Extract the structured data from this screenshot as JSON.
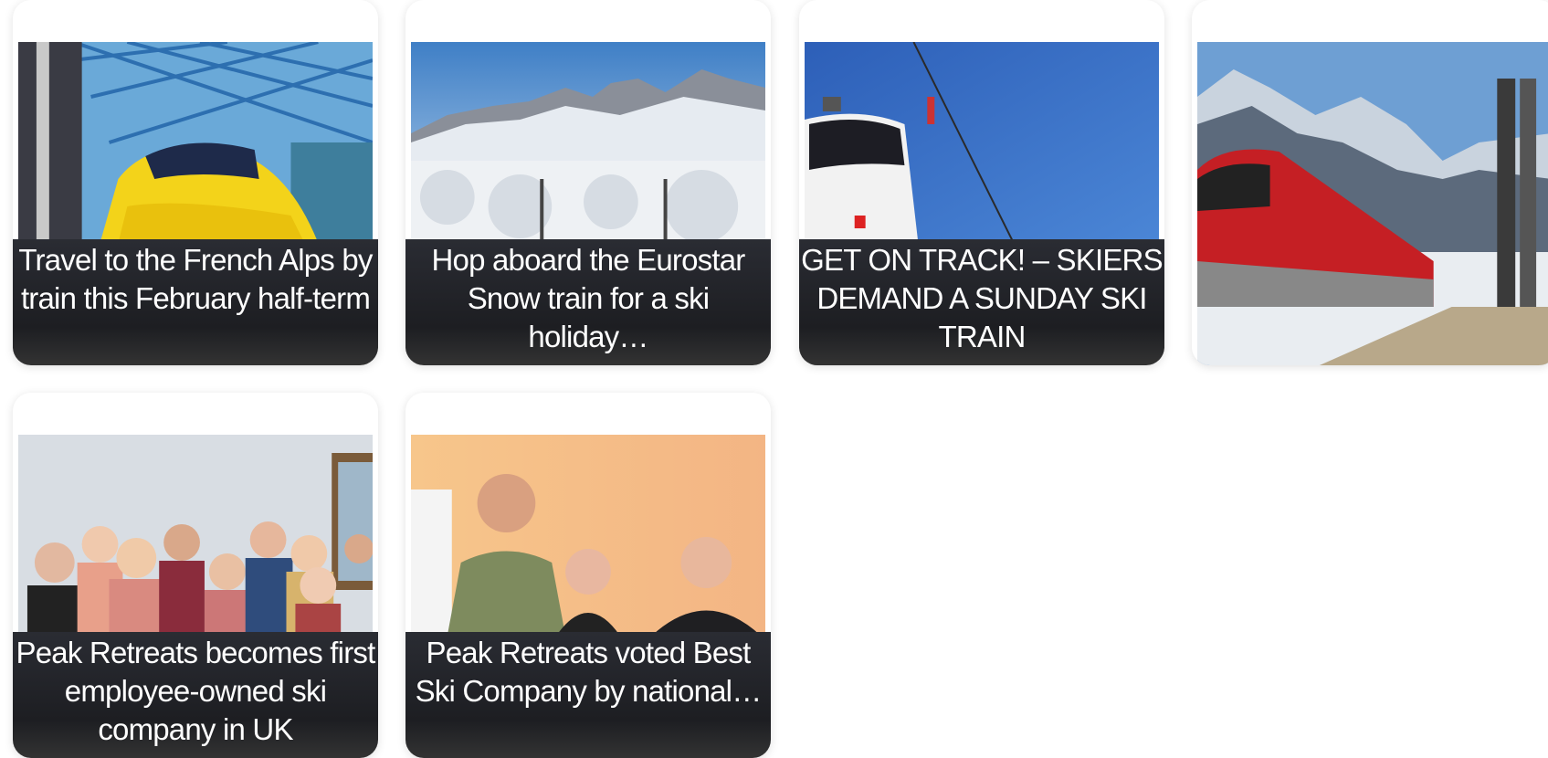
{
  "cards": [
    {
      "title": "Travel to the French Alps by train this February half-term",
      "image": "eurostar-train-station-photo"
    },
    {
      "title": "Hop aboard the Eurostar Snow train for a ski holiday…",
      "image": "snowy-mountains-photo"
    },
    {
      "title": "GET ON TRACK! – SKIERS DEMAND A SUNDAY SKI TRAIN",
      "image": "cable-car-gondola-photo"
    },
    {
      "title": "",
      "image": "red-train-alps-skis-photo"
    },
    {
      "title": "Peak Retreats becomes first employee-owned ski company in UK",
      "image": "staff-group-photo"
    },
    {
      "title": "Peak Retreats voted Best Ski Company by national…",
      "image": "award-team-photo"
    }
  ]
}
